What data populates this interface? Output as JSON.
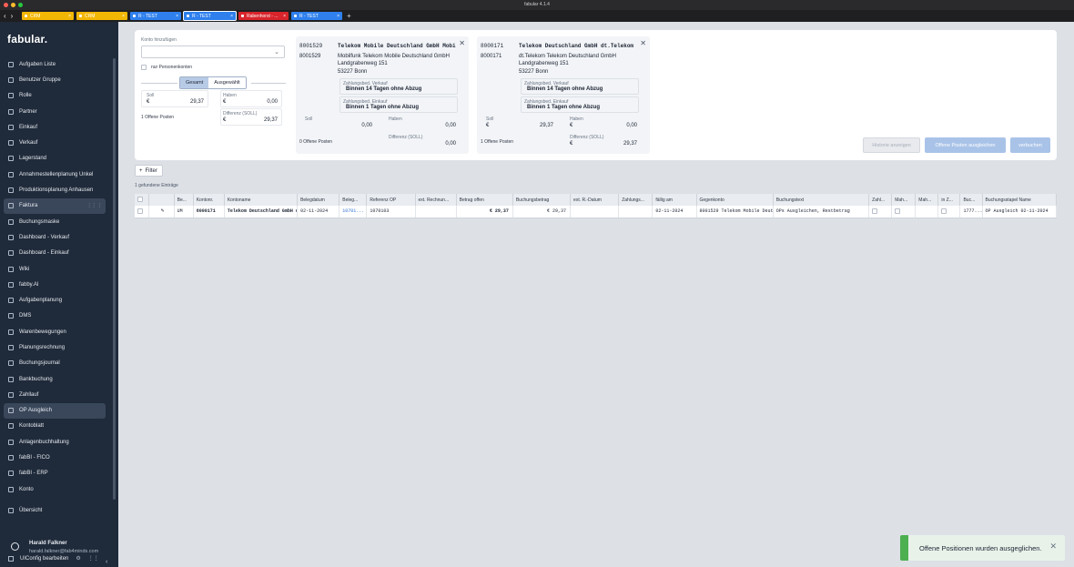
{
  "window": {
    "title": "fabular 4.1.4"
  },
  "colors": {
    "accent": "#b8cbe6",
    "sidebar_bg": "#1f2a3a",
    "success": "#4caf50",
    "tab_yellow": "#f2b705",
    "tab_blue": "#2f80ed",
    "tab_red": "#d9242b"
  },
  "tabs": [
    {
      "label": "CRM",
      "color": "#f2b705"
    },
    {
      "label": "CRM",
      "color": "#f2b705"
    },
    {
      "label": "R - TEST",
      "color": "#2f80ed"
    },
    {
      "label": "R - TEST",
      "color": "#2f80ed"
    },
    {
      "label": "Rabenhorst - ...",
      "color": "#d9242b"
    },
    {
      "label": "R - TEST",
      "color": "#2f80ed"
    }
  ],
  "sidebar": {
    "logo": "fabular.",
    "items": [
      {
        "label": "Aufgaben Liste",
        "icon": "list-icon"
      },
      {
        "label": "Benutzer Gruppe",
        "icon": "users-icon"
      },
      {
        "label": "Rolle",
        "icon": "role-icon"
      },
      {
        "label": "Partner",
        "icon": "person-icon"
      },
      {
        "label": "Einkauf",
        "icon": "cart-icon"
      },
      {
        "label": "Verkauf",
        "icon": "sales-icon"
      },
      {
        "label": "Lagerstand",
        "icon": "warehouse-icon"
      },
      {
        "label": "Annahmestellenplanung Unkel",
        "icon": "calendar-icon"
      },
      {
        "label": "Produktionsplanung Anhausen",
        "icon": "calendar-icon"
      },
      {
        "label": "Faktura",
        "icon": "invoice-icon"
      },
      {
        "label": "Buchungsmaske",
        "icon": "form-icon"
      },
      {
        "label": "Dashboard - Verkauf",
        "icon": "dashboard-icon"
      },
      {
        "label": "Dashboard - Einkauf",
        "icon": "dashboard-icon"
      },
      {
        "label": "Wiki",
        "icon": "book-icon"
      },
      {
        "label": "fabby.AI",
        "icon": "ai-icon"
      },
      {
        "label": "Aufgabenplanung",
        "icon": "gear-icon"
      },
      {
        "label": "DMS",
        "icon": "document-icon"
      },
      {
        "label": "Warenbewegungen",
        "icon": "arrows-icon"
      },
      {
        "label": "Planungsrechnung",
        "icon": "document-icon"
      },
      {
        "label": "Buchungsjournal",
        "icon": "journal-icon"
      },
      {
        "label": "Bankbuchung",
        "icon": "bank-icon"
      },
      {
        "label": "Zahllauf",
        "icon": "link-icon"
      },
      {
        "label": "OP Ausgleich",
        "icon": "link-icon"
      },
      {
        "label": "Kontoblatt",
        "icon": "document-icon"
      },
      {
        "label": "Anlagenbuchhaltung",
        "icon": "refresh-icon"
      },
      {
        "label": "fabBI - FICO",
        "icon": "document-icon"
      },
      {
        "label": "fabBI - ERP",
        "icon": "document-icon"
      },
      {
        "label": "Konto",
        "icon": "ledger-icon"
      },
      {
        "label": "Übersicht",
        "icon": "grid-icon"
      }
    ],
    "user": {
      "name": "Harald Falkner",
      "email": "harald.falkner@fab4minds.com",
      "config": "UIConfig bearbeiten"
    }
  },
  "form": {
    "add_account_label": "Konto hinzufügen",
    "only_persons_label": "nur Personenkonten",
    "seg_all": "Gesamt",
    "seg_selected": "Ausgewählt",
    "soll_label": "Soll",
    "soll_value": "29,37",
    "haben_label": "Haben",
    "haben_value": "0,00",
    "diff_label": "Differenz (SOLL)",
    "diff_value": "29,37",
    "currency": "€",
    "open_items": "1 Offene Posten"
  },
  "cards": [
    {
      "num": "8001529",
      "name": "Telekom Mobile Deutschland GmbH Mobilfun",
      "num2": "8001529",
      "addr1": "Mobilfunk Telekom Mobile Deutschland GmbH",
      "addr2": "Landgrabenweg 151",
      "addr3": "53227 Bonn",
      "zv_label": "Zahlungsbed. Verkauf",
      "zv": "Binnen 14 Tagen ohne Abzug",
      "ze_label": "Zahlungsbed. Einkauf",
      "ze": "Binnen 1 Tagen ohne Abzug",
      "soll": "0,00",
      "haben": "0,00",
      "diff": "0,00",
      "open": "0 Offene Posten"
    },
    {
      "num": "8000171",
      "name": "Telekom Deutschland GmbH dt.Telekom",
      "num2": "8000171",
      "addr1": "dt.Telekom Telekom Deutschland GmbH",
      "addr2": "Landgrabenweg 151",
      "addr3": "53227 Bonn",
      "zv_label": "Zahlungsbed. Verkauf",
      "zv": "Binnen 14 Tagen ohne Abzug",
      "ze_label": "Zahlungsbed. Einkauf",
      "ze": "Binnen 1 Tagen ohne Abzug",
      "soll": "29,37",
      "haben": "0,00",
      "diff": "29,37",
      "open": "1 Offene Posten"
    }
  ],
  "card_labels": {
    "soll": "Soll",
    "haben": "Haben",
    "diff": "Differenz (SOLL)",
    "currency": "€"
  },
  "actions": {
    "history": "Historie anzeigen",
    "balance": "Offene Posten ausgleichen",
    "post": "verbuchen"
  },
  "toolbar": {
    "filter": "Filter",
    "found": "1 gefundene Einträge"
  },
  "table": {
    "headers": [
      "",
      "",
      "Be...",
      "Kontonr.",
      "Kontoname",
      "Belegdatum",
      "Beleg...",
      "Referenz OP",
      "ext. Rechnun...",
      "Betrag offen",
      "Buchungsbetrag",
      "ext. R.-Datum",
      "Zahlungs...",
      "fällig am",
      "Gegenkonto",
      "Buchungstext",
      "Zahl...",
      "Mah...",
      "Mah...",
      "in Z...",
      "Buc...",
      "Buchungsstapel Name"
    ],
    "rows": [
      [
        "",
        "",
        "UM",
        "8000171",
        "Telekom Deutschland GmbH dt.Telekom",
        "02-11-2024",
        "10701...",
        "1070103",
        "",
        "€ 29,37",
        "€ 29,37",
        "",
        "",
        "02-11-2024",
        "8001529 Telekom Mobile Deutschland",
        "OPs Ausgleichen, Restbetrag",
        "",
        "",
        "",
        "",
        "1777...",
        "OP Ausgleich 02-11-2024"
      ]
    ]
  },
  "toast": {
    "message": "Offene Positionen wurden ausgeglichen."
  }
}
